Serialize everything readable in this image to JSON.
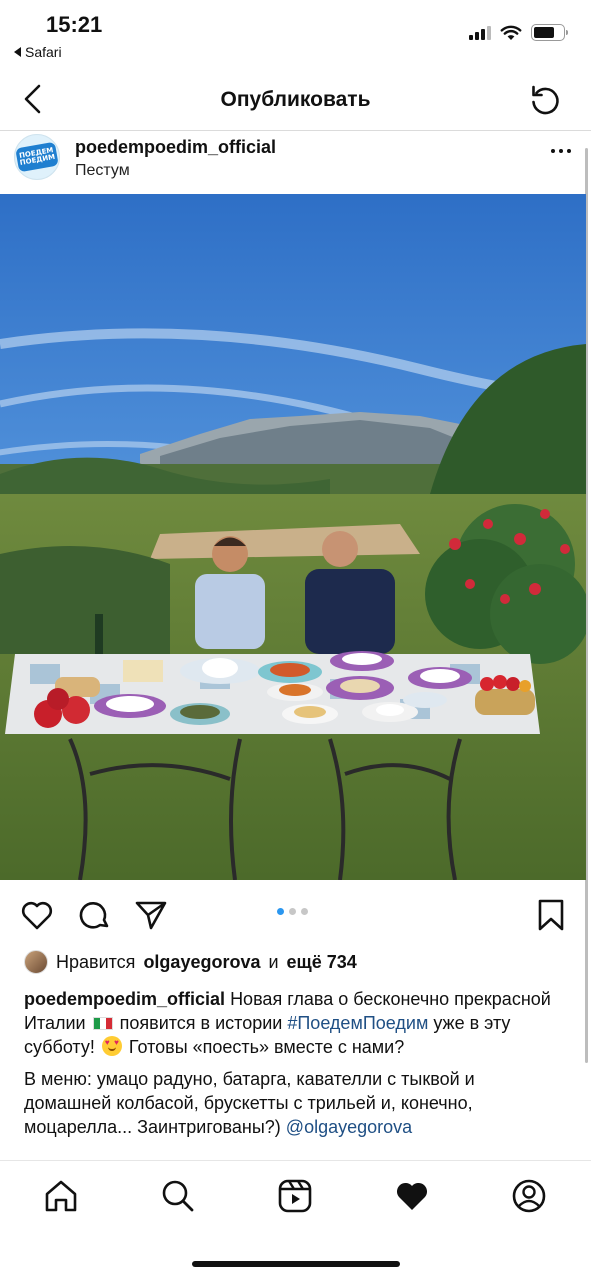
{
  "status_bar": {
    "time": "15:21",
    "back_app": "Safari",
    "icons": [
      "signal-icon",
      "wifi-icon",
      "battery-icon"
    ]
  },
  "header": {
    "title": "Опубликовать",
    "back_icon": "chevron-left-icon",
    "refresh_icon": "refresh-icon"
  },
  "post": {
    "username": "poedempoedim_official",
    "location": "Пестум",
    "avatar_text": "ПОЕДЕМ ПОЕДИМ",
    "carousel": {
      "total": 3,
      "active": 1
    },
    "likes": {
      "prefix": "Нравится",
      "user": "olgayegorova",
      "joiner": "и",
      "more": "ещё 734"
    },
    "caption": {
      "author": "poedempoedim_official",
      "line1_a": "Новая глава о бесконечно прекрасной Италии",
      "line1_b": "появится в истории",
      "hashtag": "#ПоедемПоедим",
      "line1_c": "уже в эту субботу!",
      "line1_d": "Готовы «поесть» вместе с нами?",
      "para2": "В меню: умацо радуно, батарга, кавателли с тыквой и домашней колбасой, брускетты с трильей и, конечно, моцарелла... Заинтригованы?)",
      "mention": "@olgayegorova"
    }
  },
  "tabbar": {
    "items": [
      "home-icon",
      "search-icon",
      "reels-icon",
      "heart-icon",
      "profile-icon"
    ]
  },
  "colors": {
    "link": "#1f4f84",
    "carousel_active": "#2b97f0",
    "divider": "#dbdbdb"
  }
}
